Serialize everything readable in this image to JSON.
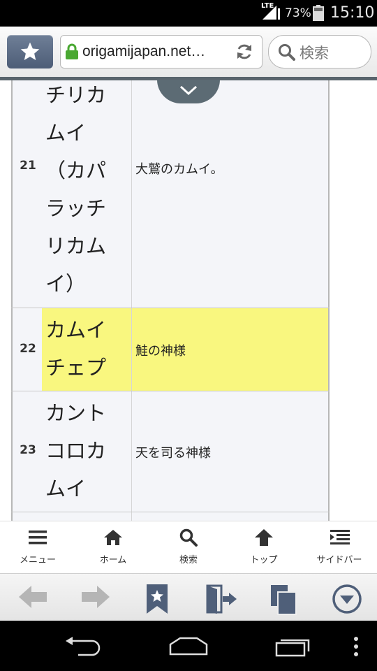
{
  "status_bar": {
    "network": "LTE",
    "battery_percent": "73%",
    "time": "15:10"
  },
  "toolbar": {
    "url": "origamijapan.net…",
    "search_placeholder": "検索"
  },
  "table": {
    "rows": [
      {
        "number": "21",
        "name": "チリカムイ（カパラッチリカムイ）",
        "description": "大鷲のカムイ。",
        "highlighted": false
      },
      {
        "number": "22",
        "name": "カムイチェプ",
        "description": "鮭の神様",
        "highlighted": true
      },
      {
        "number": "23",
        "name": "カントコロカムイ",
        "description": "天を司る神様",
        "highlighted": false
      }
    ]
  },
  "site_nav": {
    "items": [
      {
        "label": "メニュー",
        "icon": "menu-icon"
      },
      {
        "label": "ホーム",
        "icon": "home-icon"
      },
      {
        "label": "検索",
        "icon": "search-icon"
      },
      {
        "label": "トップ",
        "icon": "arrow-up-icon"
      },
      {
        "label": "サイドバー",
        "icon": "sidebar-icon"
      }
    ]
  },
  "browser_bar": {
    "icons": [
      "back-arrow-icon",
      "forward-arrow-icon",
      "bookmark-icon",
      "exit-icon",
      "tabs-icon",
      "menu-down-icon"
    ]
  },
  "colors": {
    "highlight": "#f9f77f",
    "toolbar_accent": "#59646c",
    "bookmark_button": "#5b6b84"
  }
}
